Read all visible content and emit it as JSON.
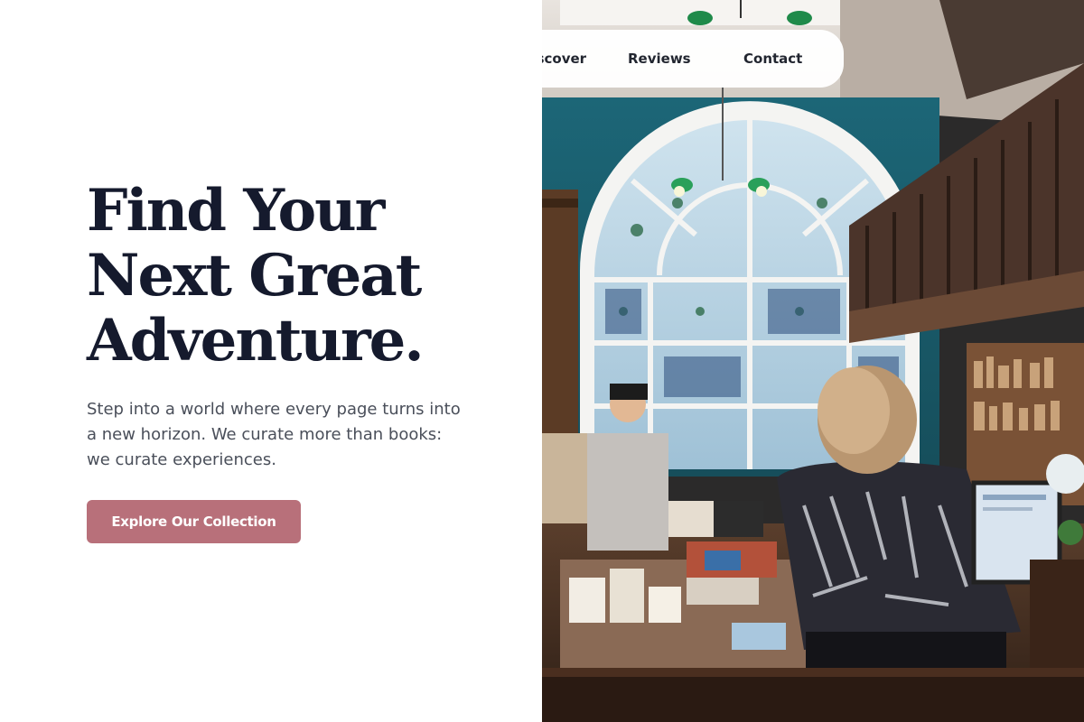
{
  "hero": {
    "heading_lines": [
      "Find Your",
      "Next Great",
      "Adventure."
    ],
    "subtitle": "Step into a world where every page turns into a new horizon. We curate more than books: we curate experiences.",
    "cta_label": "Explore Our Collection"
  },
  "nav": {
    "items": [
      {
        "label": "Discover",
        "visible_fragment": "over"
      },
      {
        "label": "Reviews"
      },
      {
        "label": "Contact"
      }
    ]
  },
  "colors": {
    "heading": "#151a2d",
    "body_text": "#4a4f5a",
    "cta_background": "#b8707a",
    "cta_text": "#ffffff",
    "nav_background": "#ffffff",
    "wall_teal": "#1e5f6e"
  }
}
